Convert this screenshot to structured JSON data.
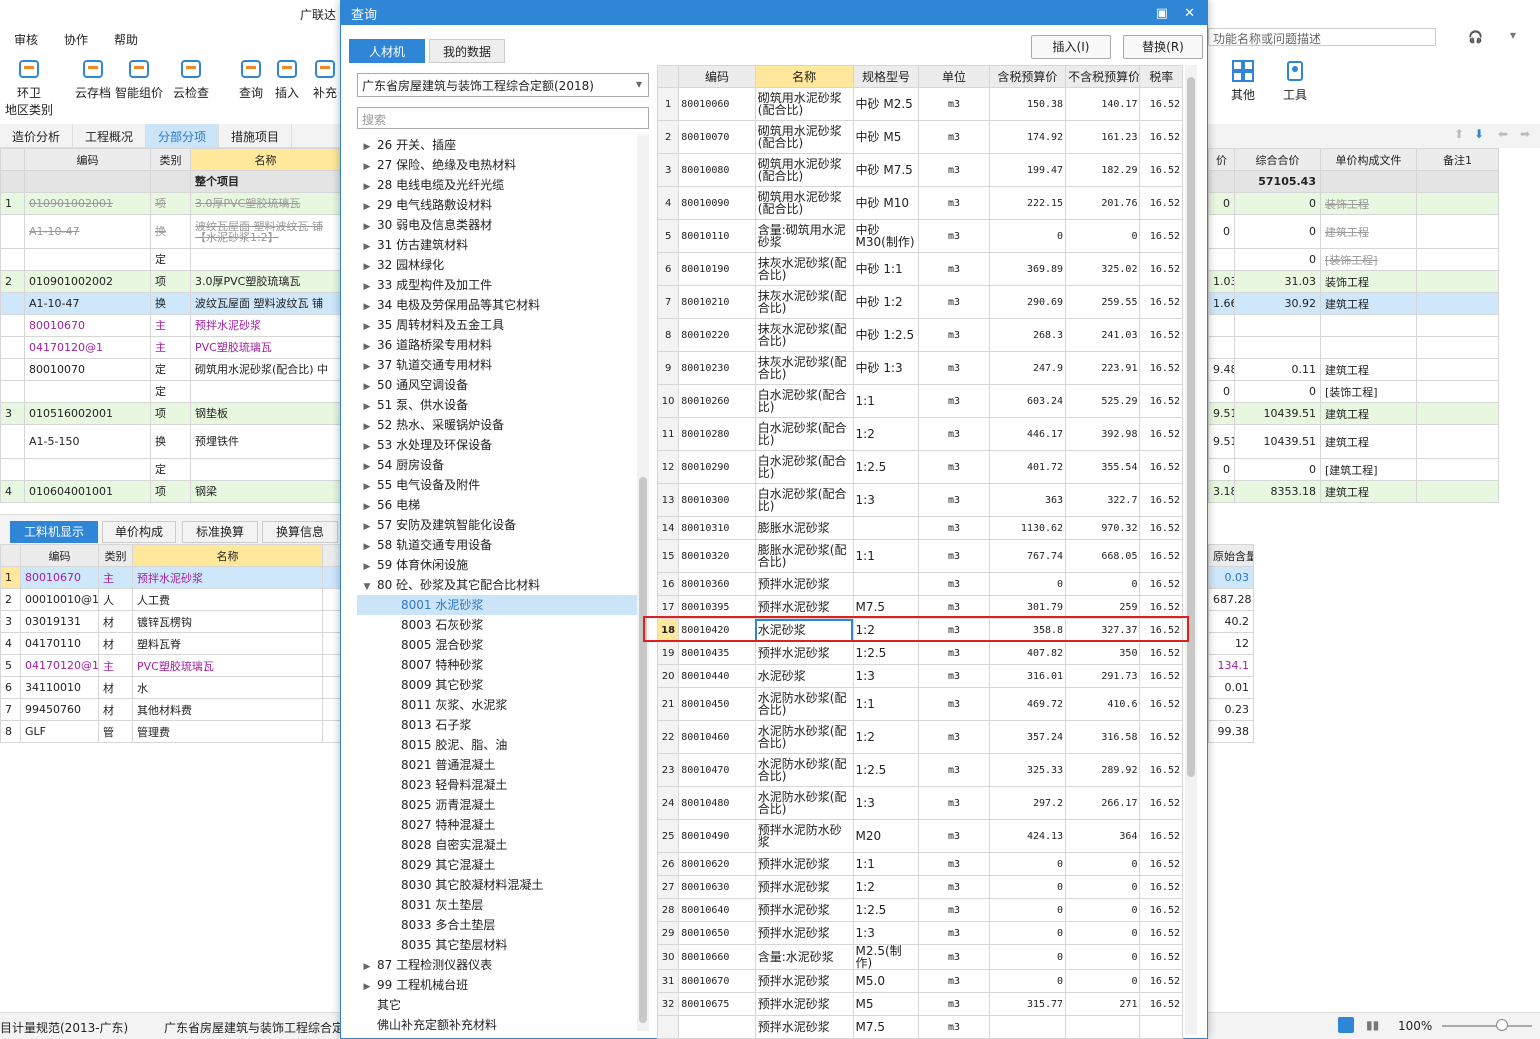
{
  "app": {
    "title": "广联达",
    "search_placeholder": "功能名称或问题描述"
  },
  "menu": [
    "审核",
    "协作",
    "帮助"
  ],
  "ribbon_left": [
    {
      "label": "环卫\n地区类别"
    },
    {
      "label": "云存档"
    },
    {
      "label": "智能组价"
    },
    {
      "label": "云检查"
    },
    {
      "label": "查询"
    },
    {
      "label": "插入"
    },
    {
      "label": "补充"
    }
  ],
  "ribbon_right": [
    {
      "label": "其他"
    },
    {
      "label": "工具"
    }
  ],
  "tabs_top": [
    "造价分析",
    "工程概况",
    "分部分项",
    "措施项目"
  ],
  "main_grid": {
    "headers": [
      "编码",
      "类别",
      "名称"
    ],
    "rows": [
      [
        "",
        "",
        "整个项目"
      ],
      [
        "010901002001",
        "项",
        "3.0厚PVC塑胶琉璃瓦"
      ],
      [
        "A1-10-47",
        "换",
        "波纹瓦屋面 塑料波纹瓦 铺 【水泥砂浆1:2】"
      ],
      [
        "",
        "定",
        ""
      ],
      [
        "010901002002",
        "项",
        "3.0厚PVC塑胶琉璃瓦"
      ],
      [
        "A1-10-47",
        "换",
        "波纹瓦屋面 塑料波纹瓦 铺"
      ],
      [
        "80010670",
        "主",
        "预拌水泥砂浆"
      ],
      [
        "04170120@1",
        "主",
        "PVC塑胶琉璃瓦"
      ],
      [
        "80010070",
        "定",
        "砌筑用水泥砂浆(配合比) 中"
      ],
      [
        "",
        "定",
        ""
      ],
      [
        "010516002001",
        "项",
        "钢垫板"
      ],
      [
        "A1-5-150",
        "换",
        "预埋铁件"
      ],
      [
        "",
        "定",
        ""
      ],
      [
        "010604001001",
        "项",
        "钢梁"
      ]
    ],
    "row_no": [
      "",
      "1",
      "",
      "",
      "2",
      "",
      "",
      "",
      "",
      "",
      "3",
      "",
      "",
      "4"
    ]
  },
  "right_grid": {
    "headers": [
      "价",
      "综合合价",
      "单价构成文件",
      "备注1"
    ],
    "total": "57105.43",
    "rows": [
      [
        "0",
        "0",
        "装饰工程"
      ],
      [
        "0",
        "0",
        "建筑工程"
      ],
      [
        "",
        "0",
        "[装饰工程]"
      ],
      [
        "1.03",
        "31.03",
        "装饰工程"
      ],
      [
        "1.66",
        "30.92",
        "建筑工程"
      ],
      [
        "",
        "",
        ""
      ],
      [
        "",
        "",
        ""
      ],
      [
        "9.48",
        "0.11",
        "建筑工程"
      ],
      [
        "0",
        "0",
        "[装饰工程]"
      ],
      [
        "9.51",
        "10439.51",
        "建筑工程"
      ],
      [
        "9.51",
        "10439.51",
        "建筑工程"
      ],
      [
        "0",
        "0",
        "[建筑工程]"
      ],
      [
        "3.18",
        "8353.18",
        "建筑工程"
      ]
    ]
  },
  "bottom_tabs": [
    "工料机显示",
    "单价构成",
    "标准换算",
    "换算信息"
  ],
  "bottom_grid": {
    "headers": [
      "编码",
      "类别",
      "名称"
    ],
    "rows": [
      [
        "1",
        "80010670",
        "主",
        "预拌水泥砂浆"
      ],
      [
        "2",
        "00010010@1",
        "人",
        "人工费"
      ],
      [
        "3",
        "03019131",
        "材",
        "镀锌瓦楞钩"
      ],
      [
        "4",
        "04170110",
        "材",
        "塑料瓦脊"
      ],
      [
        "5",
        "04170120@1",
        "主",
        "PVC塑胶琉璃瓦"
      ],
      [
        "6",
        "34110010",
        "材",
        "水"
      ],
      [
        "7",
        "99450760",
        "材",
        "其他材料费"
      ],
      [
        "8",
        "GLF",
        "管",
        "管理费"
      ]
    ]
  },
  "bottom_right": {
    "header": "原始含量",
    "values": [
      "0.03",
      "687.28",
      "40.2",
      "12",
      "134.1",
      "0.01",
      "0.23",
      "99.38"
    ]
  },
  "status": {
    "left": "目计量规范(2013-广东)",
    "mid": "广东省房屋建筑与装饰工程综合定",
    "zoom": "100%"
  },
  "dialog": {
    "title": "查询",
    "tabs": [
      "人材机",
      "我的数据"
    ],
    "insert_btn": "插入(I)",
    "replace_btn": "替换(R)",
    "library": "广东省房屋建筑与装饰工程综合定额(2018)",
    "search_placeholder": "搜索",
    "tree": [
      {
        "t": "26 开关、插座",
        "sub": false
      },
      {
        "t": "27 保险、绝缘及电热材料",
        "sub": false
      },
      {
        "t": "28 电线电缆及光纤光缆",
        "sub": false
      },
      {
        "t": "29 电气线路敷设材料",
        "sub": false
      },
      {
        "t": "30 弱电及信息类器材",
        "sub": false
      },
      {
        "t": "31 仿古建筑材料",
        "sub": false
      },
      {
        "t": "32 园林绿化",
        "sub": false
      },
      {
        "t": "33 成型构件及加工件",
        "sub": false
      },
      {
        "t": "34 电极及劳保用品等其它材料",
        "sub": false
      },
      {
        "t": "35 周转材料及五金工具",
        "sub": false
      },
      {
        "t": "36 道路桥梁专用材料",
        "sub": false
      },
      {
        "t": "37 轨道交通专用材料",
        "sub": false
      },
      {
        "t": "50 通风空调设备",
        "sub": false
      },
      {
        "t": "51 泵、供水设备",
        "sub": false
      },
      {
        "t": "52 热水、采暖锅炉设备",
        "sub": false
      },
      {
        "t": "53 水处理及环保设备",
        "sub": false
      },
      {
        "t": "54 厨房设备",
        "sub": false
      },
      {
        "t": "55 电气设备及附件",
        "sub": false
      },
      {
        "t": "56 电梯",
        "sub": false
      },
      {
        "t": "57 安防及建筑智能化设备",
        "sub": false
      },
      {
        "t": "58 轨道交通专用设备",
        "sub": false
      },
      {
        "t": "59 体育休闲设施",
        "sub": false
      },
      {
        "t": "80 砼、砂浆及其它配合比材料",
        "sub": false,
        "open": true
      },
      {
        "t": "8001 水泥砂浆",
        "sub": true,
        "sel": true
      },
      {
        "t": "8003 石灰砂浆",
        "sub": true
      },
      {
        "t": "8005 混合砂浆",
        "sub": true
      },
      {
        "t": "8007 特种砂浆",
        "sub": true
      },
      {
        "t": "8009 其它砂浆",
        "sub": true
      },
      {
        "t": "8011 灰浆、水泥浆",
        "sub": true
      },
      {
        "t": "8013 石子浆",
        "sub": true
      },
      {
        "t": "8015 胶泥、脂、油",
        "sub": true
      },
      {
        "t": "8021 普通混凝土",
        "sub": true
      },
      {
        "t": "8023 轻骨料混凝土",
        "sub": true
      },
      {
        "t": "8025 沥青混凝土",
        "sub": true
      },
      {
        "t": "8027 特种混凝土",
        "sub": true
      },
      {
        "t": "8028 自密实混凝土",
        "sub": true
      },
      {
        "t": "8029 其它混凝土",
        "sub": true
      },
      {
        "t": "8030 其它胶凝材料混凝土",
        "sub": true
      },
      {
        "t": "8031 灰土垫层",
        "sub": true
      },
      {
        "t": "8033 多合土垫层",
        "sub": true
      },
      {
        "t": "8035 其它垫层材料",
        "sub": true
      },
      {
        "t": "87 工程检测仪器仪表",
        "sub": false
      },
      {
        "t": "99 工程机械台班",
        "sub": false
      },
      {
        "t": "其它",
        "sub": false,
        "noarr": true
      },
      {
        "t": "佛山补充定额补充材料",
        "sub": false,
        "noarr": true
      }
    ],
    "grid_headers": [
      "编码",
      "名称",
      "规格型号",
      "单位",
      "含税预算价",
      "不含税预算价",
      "税率"
    ],
    "rows": [
      [
        "1",
        "80010060",
        "砌筑用水泥砂浆(配合比)",
        "中砂 M2.5",
        "m3",
        "150.38",
        "140.17",
        "16.52"
      ],
      [
        "2",
        "80010070",
        "砌筑用水泥砂浆(配合比)",
        "中砂 M5",
        "m3",
        "174.92",
        "161.23",
        "16.52"
      ],
      [
        "3",
        "80010080",
        "砌筑用水泥砂浆(配合比)",
        "中砂 M7.5",
        "m3",
        "199.47",
        "182.29",
        "16.52"
      ],
      [
        "4",
        "80010090",
        "砌筑用水泥砂浆(配合比)",
        "中砂 M10",
        "m3",
        "222.15",
        "201.76",
        "16.52"
      ],
      [
        "5",
        "80010110",
        "含量:砌筑用水泥砂浆",
        "中砂 M30(制作)",
        "m3",
        "0",
        "0",
        "16.52"
      ],
      [
        "6",
        "80010190",
        "抹灰水泥砂浆(配合比)",
        "中砂 1:1",
        "m3",
        "369.89",
        "325.02",
        "16.52"
      ],
      [
        "7",
        "80010210",
        "抹灰水泥砂浆(配合比)",
        "中砂 1:2",
        "m3",
        "290.69",
        "259.55",
        "16.52"
      ],
      [
        "8",
        "80010220",
        "抹灰水泥砂浆(配合比)",
        "中砂 1:2.5",
        "m3",
        "268.3",
        "241.03",
        "16.52"
      ],
      [
        "9",
        "80010230",
        "抹灰水泥砂浆(配合比)",
        "中砂 1:3",
        "m3",
        "247.9",
        "223.91",
        "16.52"
      ],
      [
        "10",
        "80010260",
        "白水泥砂浆(配合比)",
        "1:1",
        "m3",
        "603.24",
        "525.29",
        "16.52"
      ],
      [
        "11",
        "80010280",
        "白水泥砂浆(配合比)",
        "1:2",
        "m3",
        "446.17",
        "392.98",
        "16.52"
      ],
      [
        "12",
        "80010290",
        "白水泥砂浆(配合比)",
        "1:2.5",
        "m3",
        "401.72",
        "355.54",
        "16.52"
      ],
      [
        "13",
        "80010300",
        "白水泥砂浆(配合比)",
        "1:3",
        "m3",
        "363",
        "322.7",
        "16.52"
      ],
      [
        "14",
        "80010310",
        "膨胀水泥砂浆",
        "",
        "m3",
        "1130.62",
        "970.32",
        "16.52"
      ],
      [
        "15",
        "80010320",
        "膨胀水泥砂浆(配合比)",
        "1:1",
        "m3",
        "767.74",
        "668.05",
        "16.52"
      ],
      [
        "16",
        "80010360",
        "预拌水泥砂浆",
        "",
        "m3",
        "0",
        "0",
        "16.52"
      ],
      [
        "17",
        "80010395",
        "预拌水泥砂浆",
        "M7.5",
        "m3",
        "301.79",
        "259",
        "16.52"
      ],
      [
        "18",
        "80010420",
        "水泥砂浆",
        "1:2",
        "m3",
        "358.8",
        "327.37",
        "16.52"
      ],
      [
        "19",
        "80010435",
        "预拌水泥砂浆",
        "1:2.5",
        "m3",
        "407.82",
        "350",
        "16.52"
      ],
      [
        "20",
        "80010440",
        "水泥砂浆",
        "1:3",
        "m3",
        "316.01",
        "291.73",
        "16.52"
      ],
      [
        "21",
        "80010450",
        "水泥防水砂浆(配合比)",
        "1:1",
        "m3",
        "469.72",
        "410.6",
        "16.52"
      ],
      [
        "22",
        "80010460",
        "水泥防水砂浆(配合比)",
        "1:2",
        "m3",
        "357.24",
        "316.58",
        "16.52"
      ],
      [
        "23",
        "80010470",
        "水泥防水砂浆(配合比)",
        "1:2.5",
        "m3",
        "325.33",
        "289.92",
        "16.52"
      ],
      [
        "24",
        "80010480",
        "水泥防水砂浆(配合比)",
        "1:3",
        "m3",
        "297.2",
        "266.17",
        "16.52"
      ],
      [
        "25",
        "80010490",
        "预拌水泥防水砂浆",
        "M20",
        "m3",
        "424.13",
        "364",
        "16.52"
      ],
      [
        "26",
        "80010620",
        "预拌水泥砂浆",
        "1:1",
        "m3",
        "0",
        "0",
        "16.52"
      ],
      [
        "27",
        "80010630",
        "预拌水泥砂浆",
        "1:2",
        "m3",
        "0",
        "0",
        "16.52"
      ],
      [
        "28",
        "80010640",
        "预拌水泥砂浆",
        "1:2.5",
        "m3",
        "0",
        "0",
        "16.52"
      ],
      [
        "29",
        "80010650",
        "预拌水泥砂浆",
        "1:3",
        "m3",
        "0",
        "0",
        "16.52"
      ],
      [
        "30",
        "80010660",
        "含量:水泥砂浆",
        "M2.5(制作)",
        "m3",
        "0",
        "0",
        "16.52"
      ],
      [
        "31",
        "80010670",
        "预拌水泥砂浆",
        "M5.0",
        "m3",
        "0",
        "0",
        "16.52"
      ],
      [
        "32",
        "80010675",
        "预拌水泥砂浆",
        "M5",
        "m3",
        "315.77",
        "271",
        "16.52"
      ],
      [
        "",
        "",
        "预拌水泥砂浆",
        "M7.5",
        "m3",
        "",
        "",
        ""
      ]
    ],
    "selected_row": "18"
  }
}
